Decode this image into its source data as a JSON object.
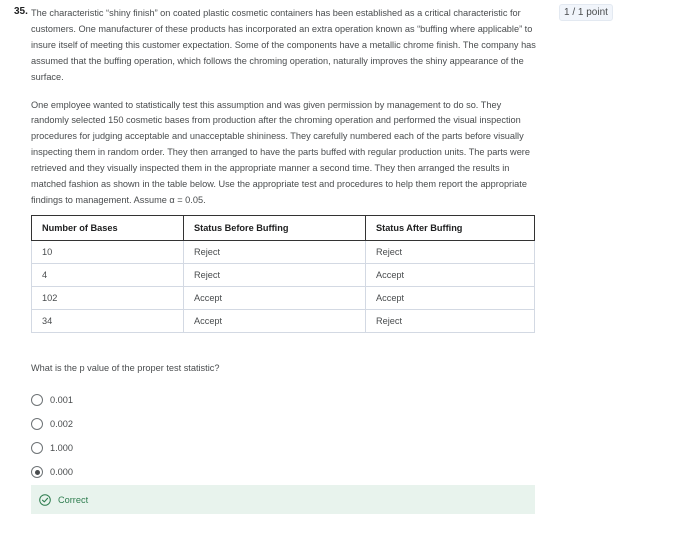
{
  "question": {
    "number": "35.",
    "points": "1 / 1 point",
    "paragraph1": "The characteristic “shiny finish” on coated plastic cosmetic containers has been established as a critical characteristic for customers. One manufacturer of these products has incorporated an extra operation known as “buffing where applicable” to insure itself of meeting this customer expectation. Some of the components have a metallic chrome finish. The company has assumed that the buffing operation, which follows the chroming operation, naturally improves the shiny appearance of the surface.",
    "paragraph2": "One employee wanted to statistically test this assumption and was given permission by management to do so. They randomly selected 150 cosmetic bases from production after the chroming operation and performed the visual inspection procedures for judging acceptable and unacceptable shininess. They carefully numbered each of the parts before visually inspecting them in random order. They then arranged to have the parts buffed with regular production units. The parts were retrieved and they visually inspected them in the appropriate manner a second time. They then arranged the results in matched fashion as shown in the table below. Use the appropriate test and procedures to help them report the appropriate findings to management. Assume α = 0.05.",
    "prompt": "What is the p value of the proper test statistic?"
  },
  "table": {
    "headers": [
      "Number of Bases",
      "Status Before Buffing",
      "Status After Buffing"
    ],
    "rows": [
      [
        "10",
        "Reject",
        "Reject"
      ],
      [
        "4",
        "Reject",
        "Accept"
      ],
      [
        "102",
        "Accept",
        "Accept"
      ],
      [
        "34",
        "Accept",
        "Reject"
      ]
    ]
  },
  "options": [
    {
      "label": "0.001",
      "selected": false
    },
    {
      "label": "0.002",
      "selected": false
    },
    {
      "label": "1.000",
      "selected": false
    },
    {
      "label": "0.000",
      "selected": true
    }
  ],
  "feedback": {
    "icon": "check-circle-icon",
    "label": "Correct",
    "color": "#2e7d4f"
  }
}
